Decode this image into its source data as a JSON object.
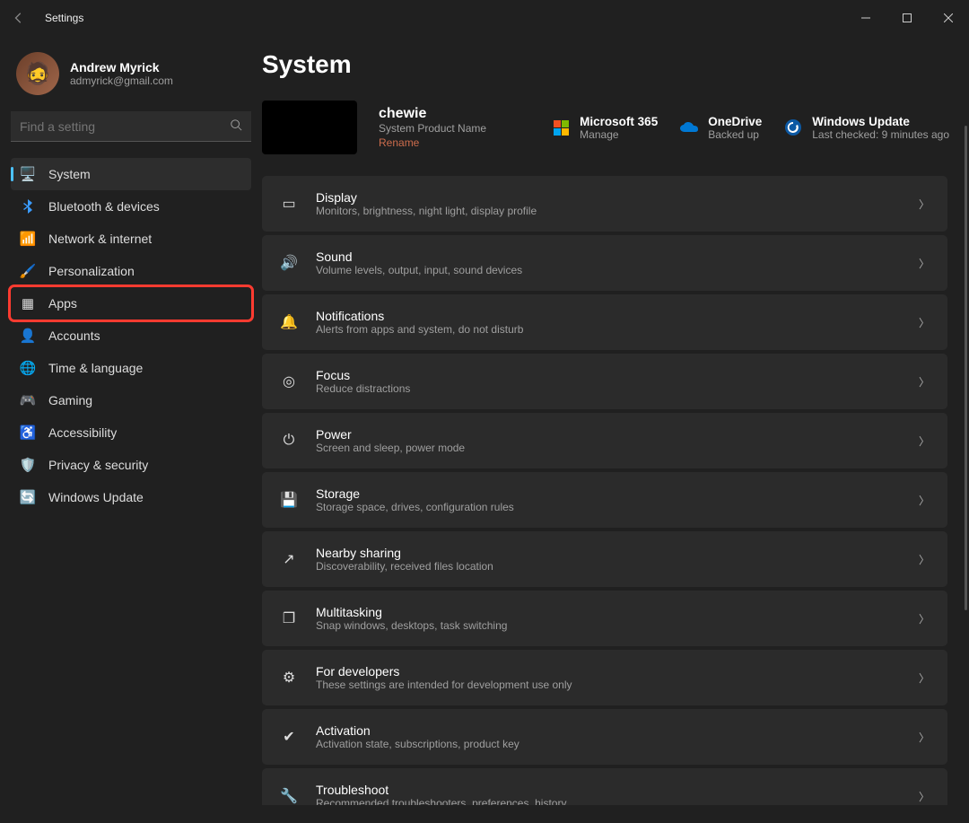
{
  "window": {
    "title": "Settings"
  },
  "user": {
    "name": "Andrew Myrick",
    "email": "admyrick@gmail.com"
  },
  "search": {
    "placeholder": "Find a setting"
  },
  "nav": {
    "items": [
      {
        "label": "System",
        "icon": "🖥️"
      },
      {
        "label": "Bluetooth & devices",
        "icon": "bt"
      },
      {
        "label": "Network & internet",
        "icon": "📶"
      },
      {
        "label": "Personalization",
        "icon": "🖌️"
      },
      {
        "label": "Apps",
        "icon": "▦"
      },
      {
        "label": "Accounts",
        "icon": "👤"
      },
      {
        "label": "Time & language",
        "icon": "🌐"
      },
      {
        "label": "Gaming",
        "icon": "🎮"
      },
      {
        "label": "Accessibility",
        "icon": "♿"
      },
      {
        "label": "Privacy & security",
        "icon": "🛡️"
      },
      {
        "label": "Windows Update",
        "icon": "🔄"
      }
    ],
    "selected": 0,
    "highlighted": 4
  },
  "page": {
    "title": "System"
  },
  "device": {
    "name": "chewie",
    "model": "System Product Name",
    "rename": "Rename"
  },
  "status": {
    "m365": {
      "title": "Microsoft 365",
      "sub": "Manage"
    },
    "onedrive": {
      "title": "OneDrive",
      "sub": "Backed up"
    },
    "update": {
      "title": "Windows Update",
      "sub": "Last checked: 9 minutes ago"
    }
  },
  "rows": [
    {
      "icon": "▭",
      "title": "Display",
      "sub": "Monitors, brightness, night light, display profile"
    },
    {
      "icon": "🔊",
      "title": "Sound",
      "sub": "Volume levels, output, input, sound devices"
    },
    {
      "icon": "🔔",
      "title": "Notifications",
      "sub": "Alerts from apps and system, do not disturb"
    },
    {
      "icon": "◎",
      "title": "Focus",
      "sub": "Reduce distractions"
    },
    {
      "icon": "⏻",
      "title": "Power",
      "sub": "Screen and sleep, power mode"
    },
    {
      "icon": "💾",
      "title": "Storage",
      "sub": "Storage space, drives, configuration rules"
    },
    {
      "icon": "↗",
      "title": "Nearby sharing",
      "sub": "Discoverability, received files location"
    },
    {
      "icon": "❐",
      "title": "Multitasking",
      "sub": "Snap windows, desktops, task switching"
    },
    {
      "icon": "⚙",
      "title": "For developers",
      "sub": "These settings are intended for development use only"
    },
    {
      "icon": "✔",
      "title": "Activation",
      "sub": "Activation state, subscriptions, product key"
    },
    {
      "icon": "🔧",
      "title": "Troubleshoot",
      "sub": "Recommended troubleshooters, preferences, history"
    }
  ]
}
